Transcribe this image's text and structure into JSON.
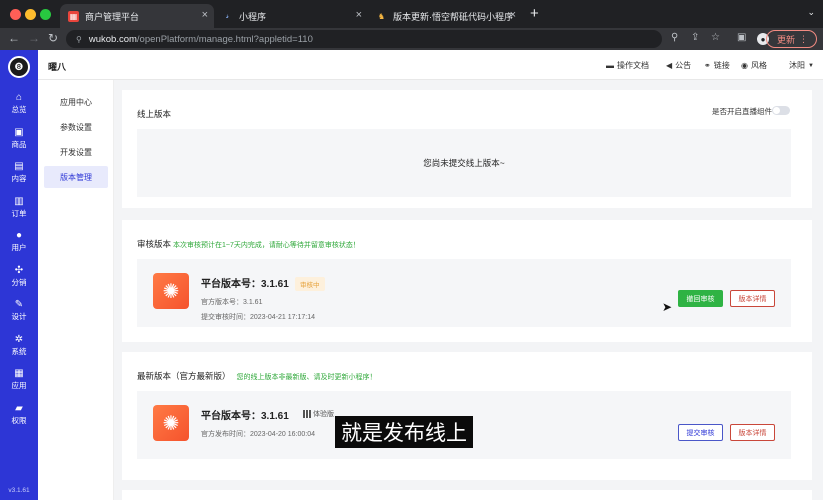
{
  "browser": {
    "tabs": [
      {
        "label": "商户管理平台",
        "icon": "store-favicon-icon"
      },
      {
        "label": "小程序",
        "icon": "miniprogram-favicon-icon"
      },
      {
        "label": "版本更新·悟空帮砥代码小程序s",
        "icon": "wukong-favicon-icon"
      }
    ],
    "url_host": "wukob.com",
    "url_path": "/openPlatform/manage.html?appletid=110",
    "update_label": "更新"
  },
  "app": {
    "shop_name": "曜八",
    "left_nav": [
      {
        "label": "总览",
        "icon": "home-icon"
      },
      {
        "label": "商品",
        "icon": "bag-icon"
      },
      {
        "label": "内容",
        "icon": "content-icon"
      },
      {
        "label": "订单",
        "icon": "order-icon"
      },
      {
        "label": "用户",
        "icon": "user-icon"
      },
      {
        "label": "分销",
        "icon": "share-icon"
      },
      {
        "label": "设计",
        "icon": "design-icon"
      },
      {
        "label": "系统",
        "icon": "gear-icon"
      },
      {
        "label": "应用",
        "icon": "apps-icon"
      },
      {
        "label": "权限",
        "icon": "lock-icon"
      }
    ],
    "version": "v3.1.61",
    "top_nav": {
      "docs": "操作文档",
      "notice": "公告",
      "link": "链接",
      "style": "风格",
      "user": "沐阳"
    },
    "sub_nav": [
      "应用中心",
      "参数设置",
      "开发设置",
      "版本管理"
    ],
    "online": {
      "title": "线上版本",
      "toggle_label": "是否开启直播组件",
      "empty_text": "您尚未提交线上版本~"
    },
    "review": {
      "title": "审核版本",
      "hint": "本次审核预计在1~7天内完成，请耐心等待并留意审核状态！",
      "platform_version": "平台版本号：3.1.61",
      "status": "审核中",
      "official_version": "官方版本号：3.1.61",
      "submit_time": "提交审核时间：2023-04-21 17:17:14",
      "withdraw_button": "撤回审核",
      "detail_button": "版本详情"
    },
    "latest": {
      "title": "最新版本（官方最新版）",
      "hint": "您的线上版本非最新版、请及时更新小程序！",
      "platform_version": "平台版本号：3.1.61",
      "experience": "体验版",
      "release_time": "官方发布时间：2023-04-20 16:00:04",
      "submit_button": "提交审核",
      "detail_button": "版本详情"
    }
  },
  "caption": "就是发布线上"
}
